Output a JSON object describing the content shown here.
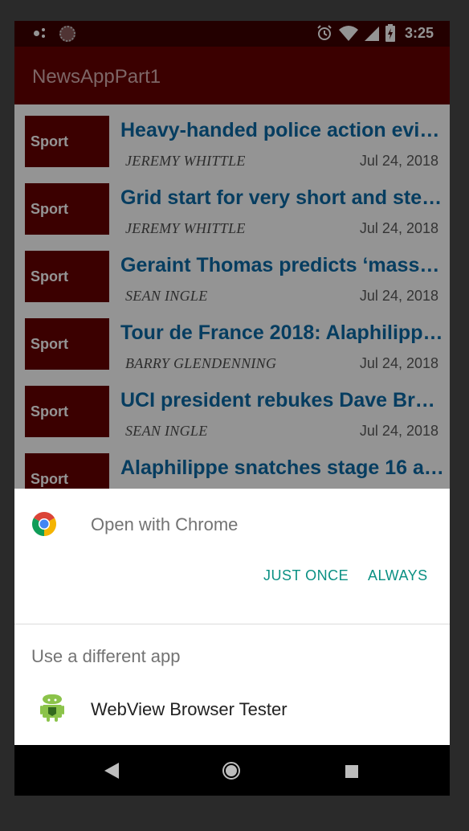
{
  "status_bar": {
    "time": "3:25",
    "icons": [
      "assistant-dots-icon",
      "sync-ring-icon",
      "alarm-icon",
      "wifi-icon",
      "signal-icon",
      "battery-icon"
    ]
  },
  "app_bar": {
    "title": "NewsAppPart1",
    "color": "#660000"
  },
  "articles": [
    {
      "section": "Sport",
      "title": "Heavy-handed police action evi…",
      "author": "JEREMY WHITTLE",
      "date": "Jul 24, 2018"
    },
    {
      "section": "Sport",
      "title": "Grid start for very short and ste…",
      "author": "JEREMY WHITTLE",
      "date": "Jul 24, 2018"
    },
    {
      "section": "Sport",
      "title": "Geraint Thomas predicts ‘massi…",
      "author": "SEAN INGLE",
      "date": "Jul 24, 2018"
    },
    {
      "section": "Sport",
      "title": "Tour de France 2018: Alaphilipp…",
      "author": "BARRY GLENDENNING",
      "date": "Jul 24, 2018"
    },
    {
      "section": "Sport",
      "title": "UCI president rebukes Dave Brai…",
      "author": "SEAN INGLE",
      "date": "Jul 24, 2018"
    },
    {
      "section": "Sport",
      "title": "Alaphilippe snatches stage 16 a…",
      "author": "",
      "date": ""
    }
  ],
  "chooser": {
    "open_with": "Open with Chrome",
    "just_once": "JUST ONCE",
    "always": "ALWAYS",
    "different_app": "Use a different app",
    "apps": [
      {
        "label": "WebView Browser Tester",
        "icon": "android-icon"
      }
    ],
    "accent_color": "#0a9083"
  },
  "nav_bar": {
    "icons": [
      "back-icon",
      "home-icon",
      "recents-icon"
    ]
  }
}
